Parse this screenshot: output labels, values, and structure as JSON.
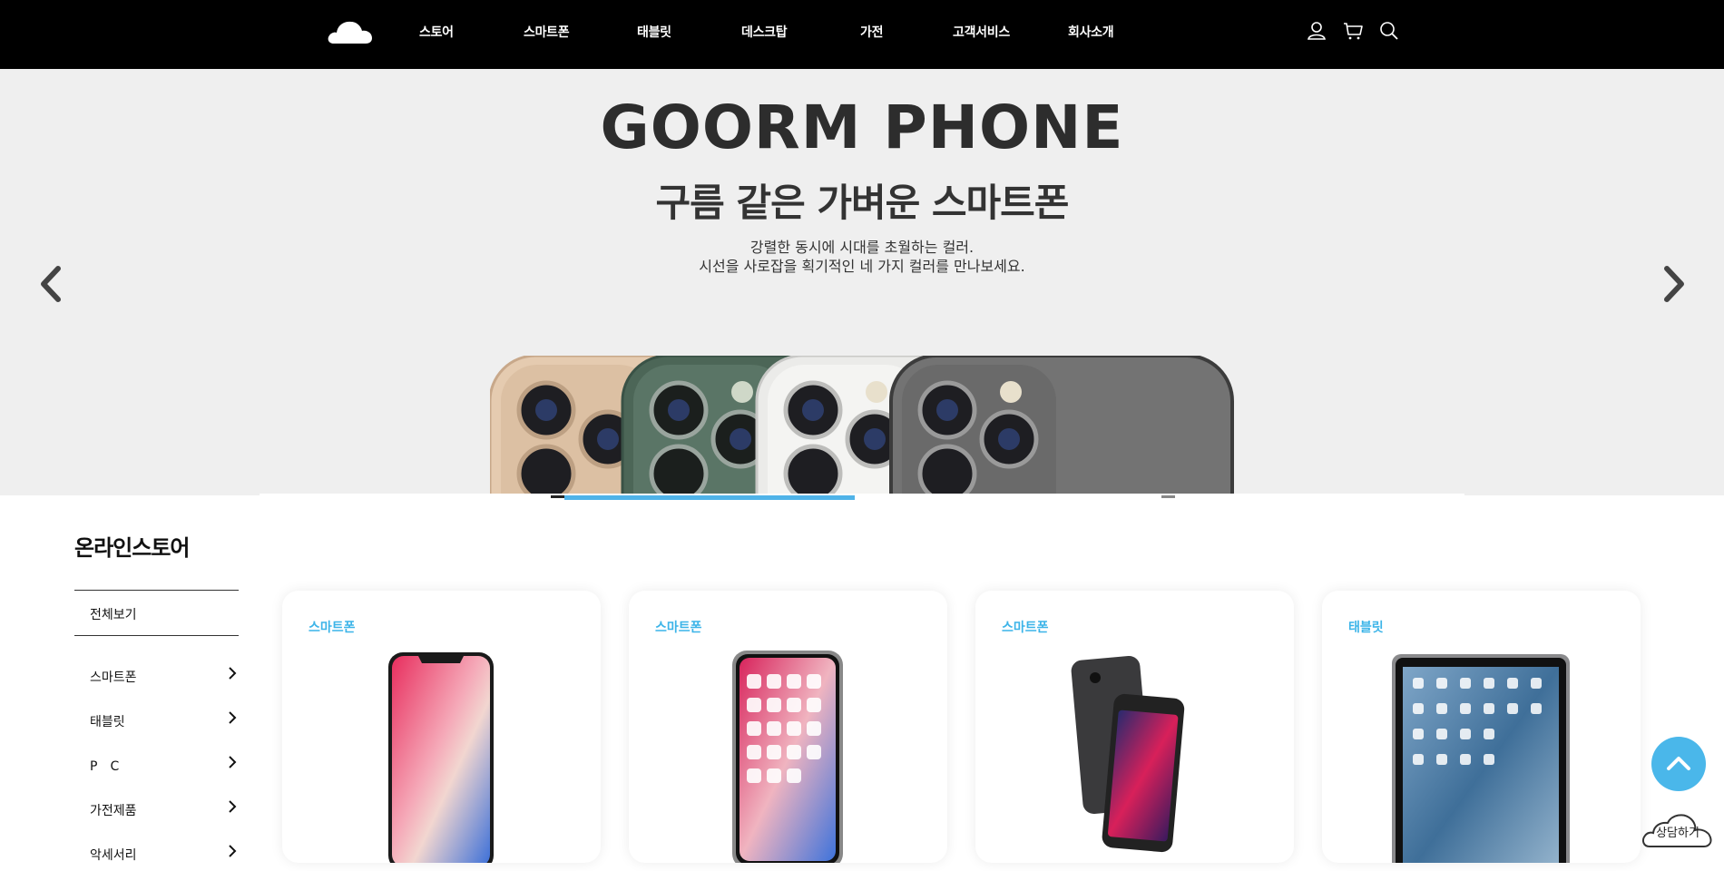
{
  "header": {
    "nav": [
      {
        "label": "스토어",
        "name": "nav-store"
      },
      {
        "label": "스마트폰",
        "name": "nav-smartphone"
      },
      {
        "label": "태블릿",
        "name": "nav-tablet"
      },
      {
        "label": "데스크탑",
        "name": "nav-desktop"
      },
      {
        "label": "가전",
        "name": "nav-appliance"
      },
      {
        "label": "고객서비스",
        "name": "nav-customer-service"
      },
      {
        "label": "회사소개",
        "name": "nav-about"
      }
    ],
    "icons": [
      "user-icon",
      "cart-icon",
      "search-icon"
    ]
  },
  "hero": {
    "title": "GOORM PHONE",
    "subtitle": "구름 같은 가벼운 스마트폰",
    "desc_line1": "강렬한 동시에 시대를 초월하는 컬러.",
    "desc_line2": "시선을 사로잡을 획기적인 네 가지 컬러를 만나보세요.",
    "phone_colors": [
      "#e3c9ad",
      "#4f6b5c",
      "#e8e8e6",
      "#6e6e6e"
    ],
    "accent": "#4fb3e8"
  },
  "store": {
    "title": "온라인스토어",
    "all_label": "전체보기",
    "categories": [
      "스마트폰",
      "태블릿",
      "P　C",
      "가전제품",
      "악세서리"
    ]
  },
  "products": [
    {
      "category": "스마트폰",
      "image": "iphone-x-front"
    },
    {
      "category": "스마트폰",
      "image": "iphone-x-homescreen"
    },
    {
      "category": "스마트폰",
      "image": "iphone-8-pair"
    },
    {
      "category": "태블릿",
      "image": "ipad-homescreen"
    }
  ],
  "floating": {
    "consult_label": "상담하기",
    "top_icon": "chevron-up-icon"
  },
  "colors": {
    "header_bg": "#000000",
    "hero_bg": "#efefef",
    "category_text": "#3cb4e8",
    "top_button": "#4ab7ea"
  }
}
